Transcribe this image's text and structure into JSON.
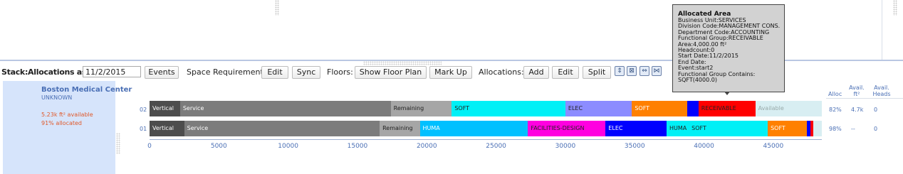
{
  "toolbar": {
    "title": "Stack:Allocations as of:",
    "date": "11/2/2015",
    "events_label": "Events",
    "space_req_label": "Space Requirements:",
    "edit_label": "Edit",
    "sync_label": "Sync",
    "floors_label": "Floors:",
    "show_floor_plan_label": "Show Floor Plan",
    "mark_up_label": "Mark Up",
    "allocations_label": "Allocations:",
    "add_label": "Add",
    "edit2_label": "Edit",
    "split_label": "Split",
    "icons": [
      "expand-icon",
      "collapse-icon",
      "fit-width-icon",
      "zoom-icon"
    ]
  },
  "building": {
    "name": "Boston Medical Center",
    "status": "UNKNOWN",
    "available": "5.23k ft² available",
    "allocated": "91% allocated"
  },
  "stats": {
    "headers": [
      "Alloc",
      "Avail. ft²",
      "Avail. Heads"
    ],
    "rows": [
      {
        "floor": "02",
        "alloc": "82%",
        "avail": "4.7k",
        "heads": "0"
      },
      {
        "floor": "01",
        "alloc": "98%",
        "avail": "--",
        "heads": "0"
      }
    ]
  },
  "chart_data": {
    "type": "bar",
    "orientation": "horizontal-stacked",
    "xlim": [
      0,
      48500
    ],
    "ticks": [
      0,
      5000,
      10000,
      15000,
      20000,
      25000,
      30000,
      35000,
      40000,
      45000
    ],
    "floors": [
      {
        "floor": "02",
        "segments": [
          {
            "label": "Vertical",
            "start": 0,
            "end": 2200,
            "color": "#4d4d4d"
          },
          {
            "label": "Service",
            "start": 2200,
            "end": 17400,
            "color": "#7c7c7c"
          },
          {
            "label": "Remaining",
            "start": 17400,
            "end": 21800,
            "color": "#a6a6a6",
            "dark": true
          },
          {
            "label": "SOFT",
            "start": 21800,
            "end": 30000,
            "color": "#00f0f6",
            "dark": true
          },
          {
            "label": "ELEC",
            "start": 30000,
            "end": 34800,
            "color": "#8c8cff",
            "dark": true
          },
          {
            "label": "SOFT",
            "start": 34800,
            "end": 38800,
            "color": "#ff8000"
          },
          {
            "label": "",
            "start": 38800,
            "end": 39600,
            "color": "#0000ff"
          },
          {
            "label": "RECEIVABLE",
            "start": 39600,
            "end": 43700,
            "color": "#ff0000",
            "dark": true
          },
          {
            "label": "Available",
            "start": 43700,
            "end": 48500,
            "color": "#d8eef2",
            "muted": true
          }
        ]
      },
      {
        "floor": "01",
        "segments": [
          {
            "label": "Vertical",
            "start": 0,
            "end": 2500,
            "color": "#4d4d4d"
          },
          {
            "label": "Service",
            "start": 2500,
            "end": 16600,
            "color": "#7c7c7c"
          },
          {
            "label": "Remaining",
            "start": 16600,
            "end": 19500,
            "color": "#a6a6a6",
            "dark": true
          },
          {
            "label": "HUMA",
            "start": 19500,
            "end": 27300,
            "color": "#00c0ff"
          },
          {
            "label": "FACILITIES-DESIGN",
            "start": 27300,
            "end": 32900,
            "color": "#ff00e0",
            "dark": true
          },
          {
            "label": "ELEC",
            "start": 32900,
            "end": 37300,
            "color": "#0000ff"
          },
          {
            "label": "HUMA",
            "start": 37300,
            "end": 38900,
            "color": "#00f0f6",
            "dark": true
          },
          {
            "label": "SOFT",
            "start": 38900,
            "end": 44600,
            "color": "#00f0f6",
            "dark": true
          },
          {
            "label": "SOFT",
            "start": 44600,
            "end": 47400,
            "color": "#ff8000"
          },
          {
            "label": "",
            "start": 47400,
            "end": 47700,
            "color": "#0000ff"
          },
          {
            "label": "",
            "start": 47700,
            "end": 47900,
            "color": "#ff0000"
          },
          {
            "label": "",
            "start": 47900,
            "end": 48500,
            "color": "#d8eef2"
          }
        ]
      }
    ]
  },
  "tooltip": {
    "title": "Allocated Area",
    "lines": [
      "Business Unit:SERVICES",
      "Division Code:MANAGEMENT CONS.",
      "Department Code:ACCOUNTING",
      "Functional Group:RECEIVABLE",
      "Area:4,000.00 ft²",
      "Headcount:0",
      "Start Date:11/2/2015",
      "End Date:",
      "Event:start2",
      "Functional Group Contains:",
      "SQFT(4000.0)"
    ]
  }
}
